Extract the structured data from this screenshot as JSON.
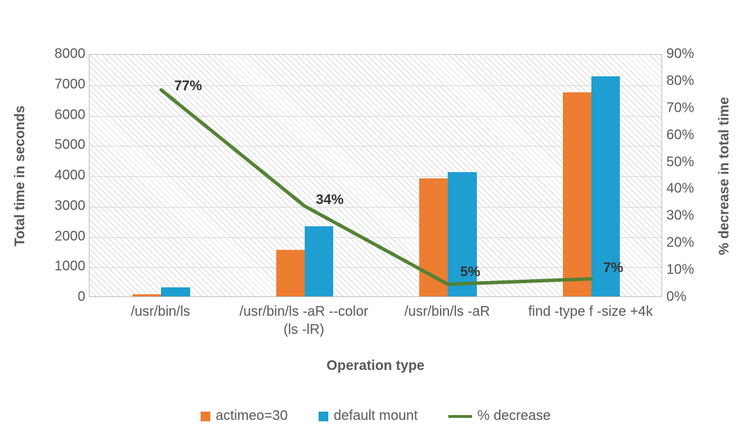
{
  "chart_data": {
    "type": "bar",
    "title": "",
    "xlabel": "Operation type",
    "ylabel_left": "Total time in seconds",
    "ylabel_right": "% decrease in total time",
    "ylim_left": [
      0,
      8000
    ],
    "ytick_left": [
      0,
      1000,
      2000,
      3000,
      4000,
      5000,
      6000,
      7000,
      8000
    ],
    "ylim_right": [
      0,
      90
    ],
    "ytick_right": [
      "0%",
      "10%",
      "20%",
      "30%",
      "40%",
      "50%",
      "60%",
      "70%",
      "80%",
      "90%"
    ],
    "categories": [
      "/usr/bin/ls",
      "/usr/bin/ls -aR --color (ls -lR)",
      "/usr/bin/ls -aR",
      "find -type f -size +4k"
    ],
    "series": [
      {
        "name": "actimeo=30",
        "axis": "left",
        "type": "bar",
        "color": "#ed7d31",
        "values": [
          70,
          1530,
          3880,
          6720
        ]
      },
      {
        "name": "default mount",
        "axis": "left",
        "type": "bar",
        "color": "#1f9ed1",
        "values": [
          300,
          2320,
          4090,
          7250
        ]
      },
      {
        "name": "% decrease",
        "axis": "right",
        "type": "line",
        "color": "#548235",
        "values": [
          77,
          34,
          5,
          7
        ],
        "labels": [
          "77%",
          "34%",
          "5%",
          "7%"
        ]
      }
    ],
    "legend": [
      "actimeo=30",
      "default mount",
      "% decrease"
    ]
  }
}
